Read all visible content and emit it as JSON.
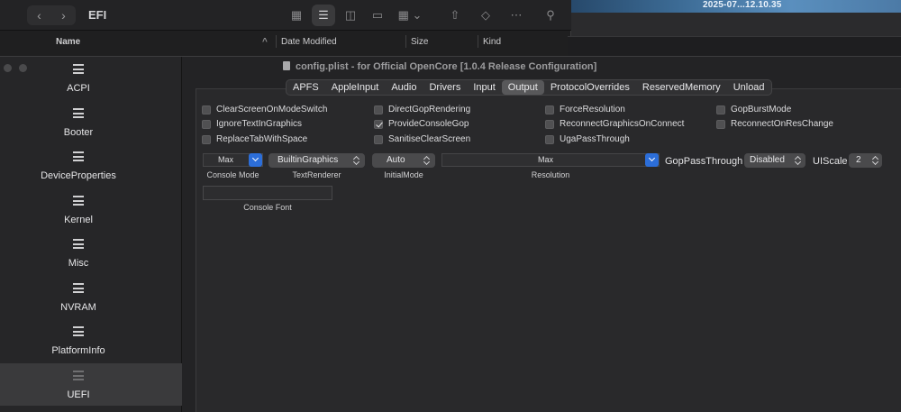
{
  "desktop": {
    "timestamp": "2025-07...12.10.35"
  },
  "finder": {
    "title": "EFI",
    "columns": [
      "Name",
      "Date Modified",
      "Size",
      "Kind"
    ],
    "sort_indicator": "^"
  },
  "ocat": {
    "window_title": "config.plist - for Official OpenCore [1.0.4 Release Configuration]",
    "sidebar": [
      {
        "label": "ACPI"
      },
      {
        "label": "Booter"
      },
      {
        "label": "DeviceProperties"
      },
      {
        "label": "Kernel"
      },
      {
        "label": "Misc"
      },
      {
        "label": "NVRAM"
      },
      {
        "label": "PlatformInfo"
      },
      {
        "label": "UEFI"
      }
    ],
    "selected_sidebar": "UEFI",
    "tabs": [
      "APFS",
      "AppleInput",
      "Audio",
      "Drivers",
      "Input",
      "Output",
      "ProtocolOverrides",
      "ReservedMemory",
      "Unload"
    ],
    "selected_tab": "Output",
    "checkboxes": [
      {
        "label": "ClearScreenOnModeSwitch",
        "checked": false
      },
      {
        "label": "DirectGopRendering",
        "checked": false
      },
      {
        "label": "ForceResolution",
        "checked": false
      },
      {
        "label": "GopBurstMode",
        "checked": false
      },
      {
        "label": "IgnoreTextInGraphics",
        "checked": false
      },
      {
        "label": "ProvideConsoleGop",
        "checked": true
      },
      {
        "label": "ReconnectGraphicsOnConnect",
        "checked": false
      },
      {
        "label": "ReconnectOnResChange",
        "checked": false
      },
      {
        "label": "ReplaceTabWithSpace",
        "checked": false
      },
      {
        "label": "SanitiseClearScreen",
        "checked": false
      },
      {
        "label": "UgaPassThrough",
        "checked": false
      }
    ],
    "controls": {
      "console_mode": {
        "value": "Max",
        "label": "Console Mode"
      },
      "text_renderer": {
        "value": "BuiltinGraphics",
        "label": "TextRenderer"
      },
      "initial_mode": {
        "value": "Auto",
        "label": "InitialMode"
      },
      "resolution": {
        "value": "Max",
        "label": "Resolution"
      },
      "gop_pass_through": {
        "label": "GopPassThrough",
        "value": "Disabled"
      },
      "ui_scale": {
        "label": "UIScale",
        "value": "2"
      },
      "console_font": {
        "value": "",
        "label": "Console Font"
      }
    }
  },
  "colors": {
    "accent": "#2c6ed9",
    "selected_tab": "#58585a",
    "sidebar_selected": "#3a3a3c"
  }
}
